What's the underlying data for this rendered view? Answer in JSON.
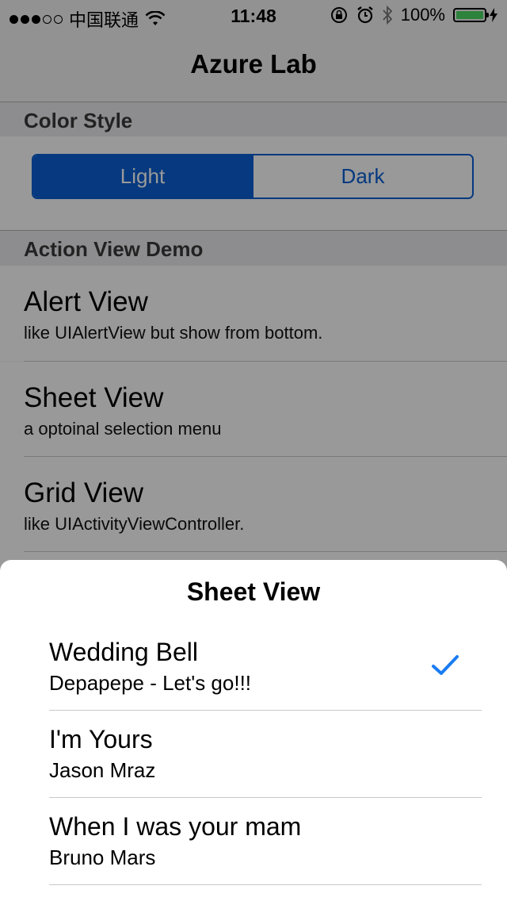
{
  "status_bar": {
    "carrier": "中国联通",
    "time": "11:48",
    "battery": "100%",
    "battery_level": 1.0,
    "signal_strength": 3,
    "signal_max": 5,
    "icons": [
      "wifi-icon",
      "orientation-lock-icon",
      "alarm-icon",
      "bluetooth-icon",
      "battery-icon",
      "charging-icon"
    ]
  },
  "nav": {
    "title": "Azure Lab"
  },
  "color_style": {
    "header": "Color Style",
    "options": [
      "Light",
      "Dark"
    ],
    "selected": "Light"
  },
  "action_view": {
    "header": "Action View Demo",
    "rows": [
      {
        "title": "Alert View",
        "subtitle": "like UIAlertView but show from bottom."
      },
      {
        "title": "Sheet View",
        "subtitle": "a optoinal selection menu"
      },
      {
        "title": "Grid View",
        "subtitle": "like UIActivityViewController."
      }
    ]
  },
  "sheet": {
    "title": "Sheet View",
    "items": [
      {
        "title": "Wedding Bell",
        "subtitle": "Depapepe - Let's go!!!",
        "checked": true
      },
      {
        "title": "I'm Yours",
        "subtitle": "Jason Mraz",
        "checked": false
      },
      {
        "title": "When I was your mam",
        "subtitle": "Bruno Mars",
        "checked": false
      }
    ]
  },
  "colors": {
    "accent": "#0a5fd4",
    "check": "#1a7cf2",
    "battery_fill": "#4cd964"
  }
}
